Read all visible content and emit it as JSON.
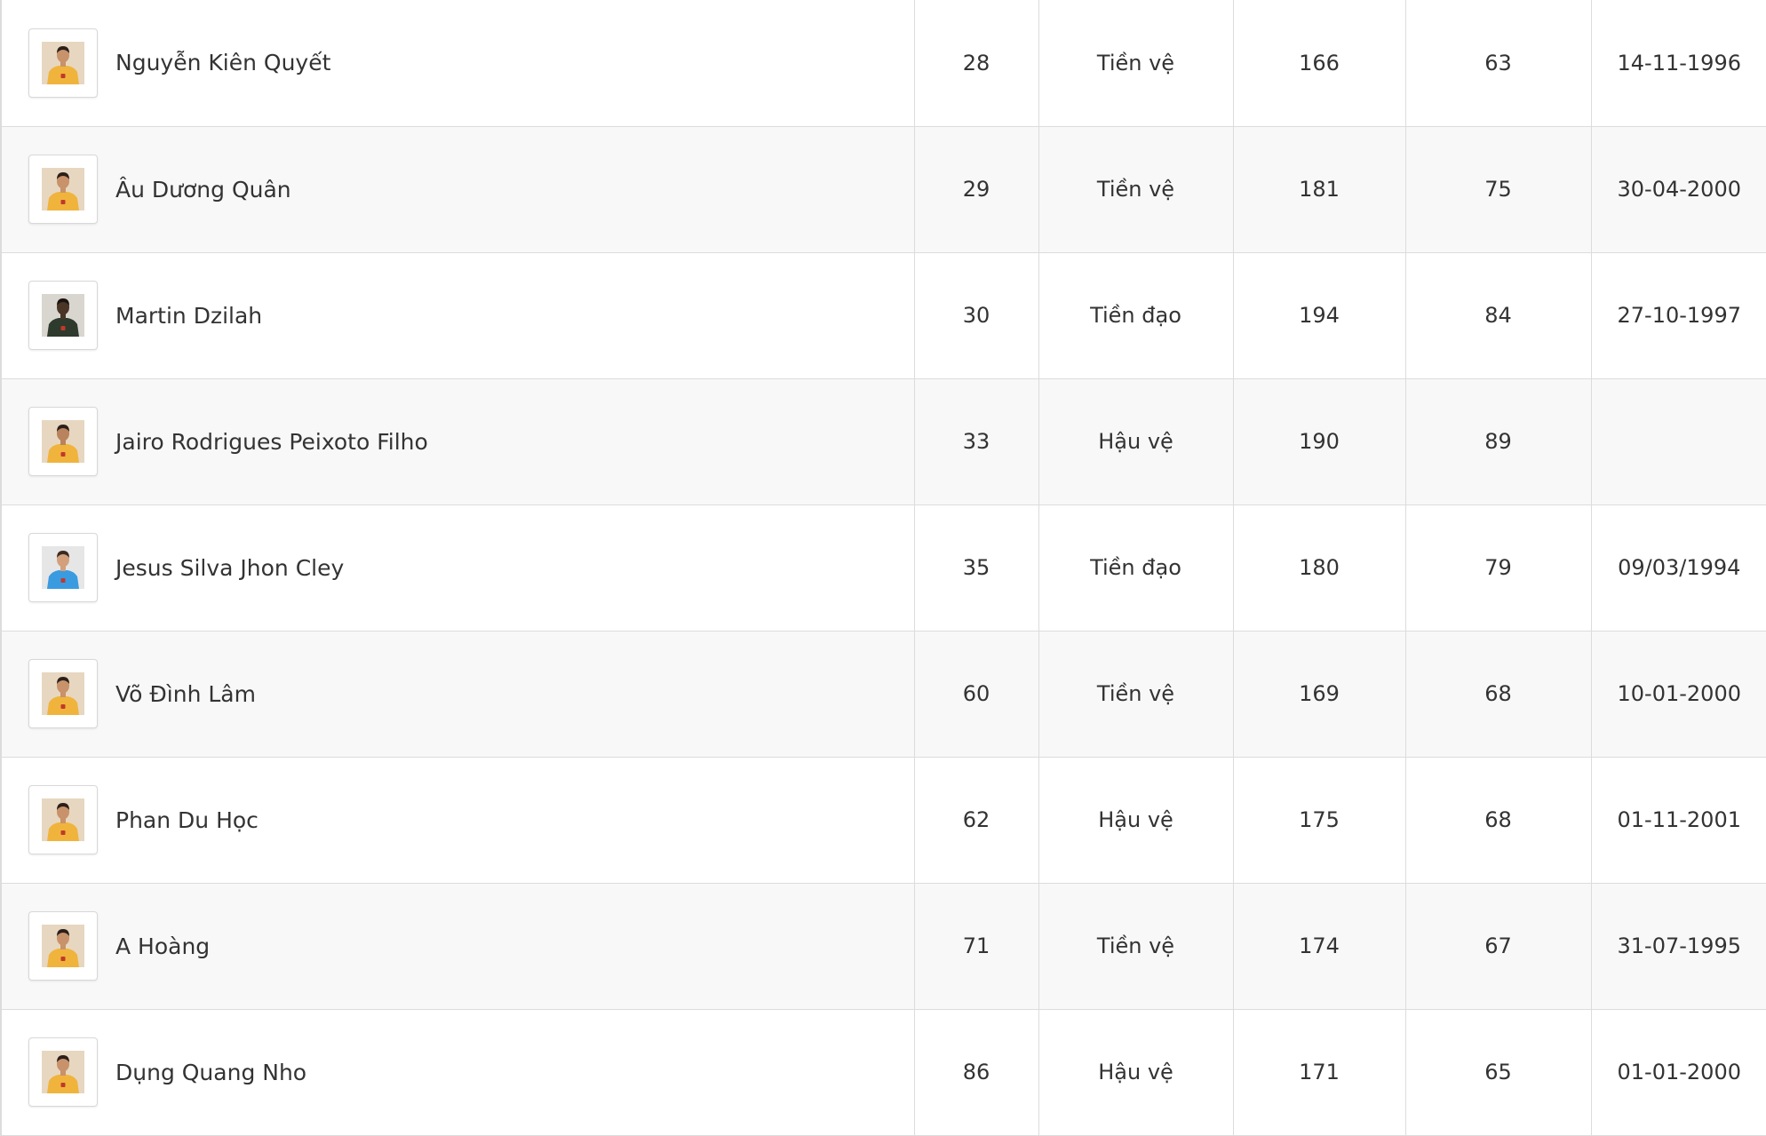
{
  "players": [
    {
      "name": "Nguyễn Kiên Quyết",
      "number": "28",
      "position": "Tiền vệ",
      "height": "166",
      "weight": "63",
      "dob": "14-11-1996",
      "photo_icon": "player-photo-icon",
      "bg": "#e7d7c1",
      "shirt": "#f0b43c",
      "skin": "#c8926a",
      "hair": "#2a1f1a"
    },
    {
      "name": "Âu Dương Quân",
      "number": "29",
      "position": "Tiền vệ",
      "height": "181",
      "weight": "75",
      "dob": "30-04-2000",
      "photo_icon": "player-photo-icon",
      "bg": "#e7d7c1",
      "shirt": "#f0b43c",
      "skin": "#c8926a",
      "hair": "#2a1f1a"
    },
    {
      "name": "Martin Dzilah",
      "number": "30",
      "position": "Tiền đạo",
      "height": "194",
      "weight": "84",
      "dob": "27-10-1997",
      "photo_icon": "player-photo-icon",
      "bg": "#d9d6d0",
      "shirt": "#2e3a2c",
      "skin": "#4a3526",
      "hair": "#1a1410"
    },
    {
      "name": "Jairo Rodrigues Peixoto Filho",
      "number": "33",
      "position": "Hậu vệ",
      "height": "190",
      "weight": "89",
      "dob": "",
      "photo_icon": "player-photo-icon",
      "bg": "#e7d7c1",
      "shirt": "#f0b43c",
      "skin": "#b9835d",
      "hair": "#2a1f1a"
    },
    {
      "name": "Jesus Silva Jhon Cley",
      "number": "35",
      "position": "Tiền đạo",
      "height": "180",
      "weight": "79",
      "dob": "09/03/1994",
      "photo_icon": "player-photo-icon",
      "bg": "#e6e6e6",
      "shirt": "#3a9be0",
      "skin": "#d2a07c",
      "hair": "#3b2a20"
    },
    {
      "name": "Võ Đình Lâm",
      "number": "60",
      "position": "Tiền vệ",
      "height": "169",
      "weight": "68",
      "dob": "10-01-2000",
      "photo_icon": "player-photo-icon",
      "bg": "#e7d7c1",
      "shirt": "#f0b43c",
      "skin": "#c8926a",
      "hair": "#2a1f1a"
    },
    {
      "name": "Phan Du Học",
      "number": "62",
      "position": "Hậu vệ",
      "height": "175",
      "weight": "68",
      "dob": "01-11-2001",
      "photo_icon": "player-photo-icon",
      "bg": "#e7d7c1",
      "shirt": "#f0b43c",
      "skin": "#c8926a",
      "hair": "#2a1f1a"
    },
    {
      "name": "A Hoàng",
      "number": "71",
      "position": "Tiền vệ",
      "height": "174",
      "weight": "67",
      "dob": "31-07-1995",
      "photo_icon": "player-photo-icon",
      "bg": "#e7d7c1",
      "shirt": "#f0b43c",
      "skin": "#c8926a",
      "hair": "#2a1f1a"
    },
    {
      "name": "Dụng Quang Nho",
      "number": "86",
      "position": "Hậu vệ",
      "height": "171",
      "weight": "65",
      "dob": "01-01-2000",
      "photo_icon": "player-photo-icon",
      "bg": "#e7d7c1",
      "shirt": "#f0b43c",
      "skin": "#c8926a",
      "hair": "#2a1f1a"
    }
  ],
  "colors": {
    "row_odd": "#ffffff",
    "row_even": "#f8f8f8",
    "border": "#dcdcdc",
    "text": "#333333"
  }
}
